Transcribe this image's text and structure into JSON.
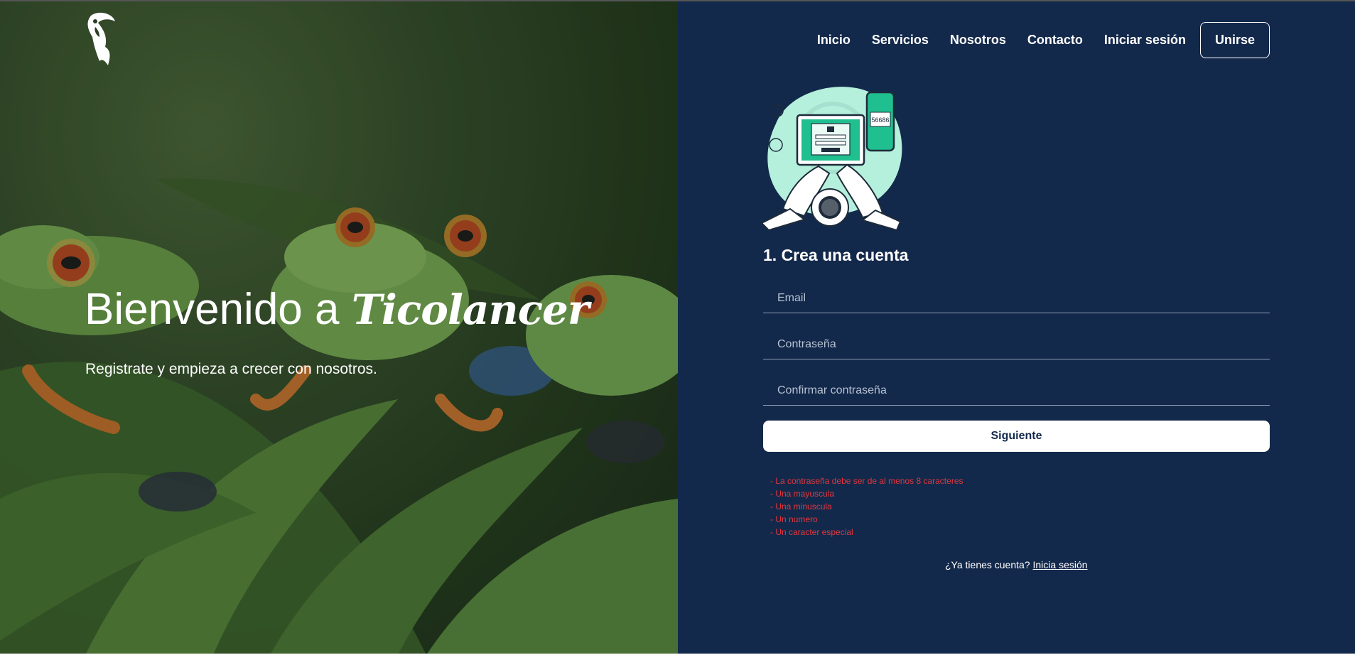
{
  "hero": {
    "title_prefix": "Bienvenido a",
    "brand": "Ticolancer",
    "subtitle": "Registrate y empieza a crecer con nosotros."
  },
  "nav": {
    "items": [
      {
        "label": "Inicio"
      },
      {
        "label": "Servicios"
      },
      {
        "label": "Nosotros"
      },
      {
        "label": "Contacto"
      },
      {
        "label": "Iniciar sesión"
      }
    ],
    "join_label": "Unirse"
  },
  "illustration": {
    "code_text": "56686"
  },
  "form": {
    "step_title": "1. Crea una cuenta",
    "email_placeholder": "Email",
    "password_placeholder": "Contraseña",
    "confirm_placeholder": "Confirmar contraseña",
    "next_label": "Siguiente"
  },
  "password_rules": [
    "- La contraseña debe ser de al menos 8 caracteres",
    "- Una mayuscula",
    "- Una minuscula",
    "- Un numero",
    "- Un caracter especial"
  ],
  "footer": {
    "question": "¿Ya tienes cuenta?",
    "link": "Inicia sesión"
  },
  "colors": {
    "panel_bg": "#13294b",
    "error": "#e4363c",
    "illustration_accent": "#1fbf8f",
    "illustration_blob": "#b5f0dd"
  },
  "icons": [
    "toucan-logo",
    "login-illustration"
  ]
}
